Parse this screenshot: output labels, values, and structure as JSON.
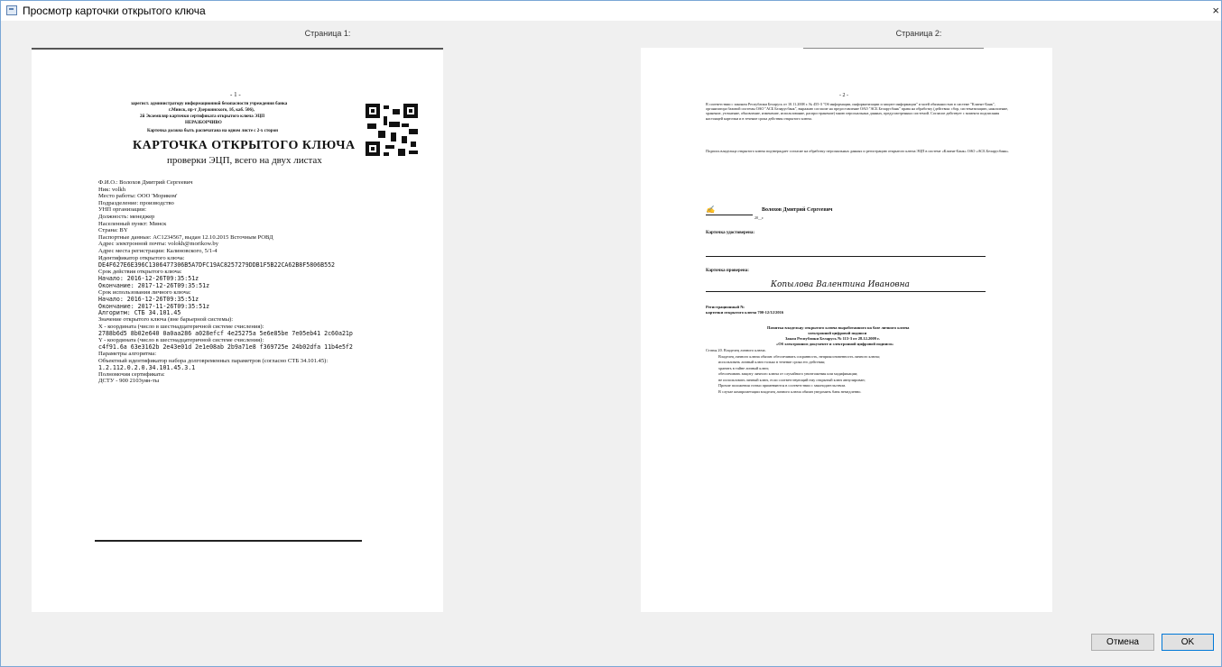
{
  "window": {
    "title": "Просмотр карточки открытого ключа",
    "close_glyph": "×"
  },
  "pages": {
    "page1_label": "Страница 1:",
    "page2_label": "Страница 2:"
  },
  "doc1": {
    "page_num": "- 1 -",
    "header_l1": "зарегист. администратору информационной безопасности учреждения банка",
    "header_l2": "г.Минск, пр-т Дзержинского, 1б, каб. 506),",
    "header_l3": "2й Экземпляр карточки сертификата открытого ключа ЭЦП",
    "header_l4": "НЕРАЗБОРЧИВО",
    "header_l5": "Карточка должна быть распечатана на одном листе с 2-х сторон",
    "title_main": "КАРТОЧКА ОТКРЫТОГО КЛЮЧА",
    "title_sub": "проверки ЭЦП, всего на двух листах",
    "fields": [
      "Ф.И.О.: Волохов Дмитрий Сергеевич",
      "Ник: volkh",
      "Место работы: ООО 'Мориком'",
      "Подразделение: производство",
      "УНП организации:",
      "Должность: менеджер",
      "Населенный пункт: Минск",
      "Страна: BY",
      "Паспортные данные: AC1234567, выдан 12.10.2015 Всточным РОВД",
      "Адрес электронной почты: volokh@morikow.by",
      "Адрес места регистрации: Калиновского, 5/1-4",
      "Идентификатор открытого ключа:",
      "DE4F627E6E396C1306477306B5A7DFC19AC8257279DDB1F5B22CA62B8F5806B552",
      "Срок действия открытого ключа:",
      "Начало: 2016-12-26T09:35:51z",
      "Окончание: 2017-12-26T09:35:51z",
      "Срок использования личного ключа:",
      "Начало: 2016-12-26T09:35:51z",
      "Окончание: 2017-11-26T09:35:51z",
      "Алгоритм: СТБ 34.101.45",
      "Значение открытого ключа (вне барьерной системы):",
      "X - координата (число в шестнадцатеричной системе счисления):",
      "2788b6d5 8b02e640 0a0aa286 a028efcf 4e25275a 5e6e85be 7e05eb41 2c60a21p",
      "Y - координата (число в шестнадцатеричной системе счисления):",
      "c4f91.6a 63e3162b 2e43e01d 2e1e08ab 2b9a71e8 f369725e 24b02dfa 11b4e5f2",
      "Параметры алгоритма:",
      "Объектный идентификатор набора долговременных параметров (согласно СТБ 34.101.45):",
      "1.2.112.0.2.0.34.101.45.3.1",
      "Полномочия сертификата:",
      "ДСТУ - 900 2103уян-ты"
    ]
  },
  "doc2": {
    "page_num": "- 2 -",
    "intro": "В соответствии с законом Республики Беларусь от 10.11.2008 г. № 455-З \"Об информации, информатизации и защите информации\" и моей обязанностью в системе \"Клиент-Банк\", организатора базовой системы ОАО \"АСБ Беларусбанк\", выражаю согласие на предоставление ОАО \"АСБ Беларусбанк\" права на обработку (действия: сбор, систематизацию, накопление, хранение, уточнение, обновление, изменение, использование, распространение) мною персональных данных, предусмотренных системой. Согласие действует с момента подписания настоящей карточки и в течение срока действия открытого ключа.",
    "consent": "Подпись владельца открытого ключа подтверждает согласие на обработку персональных данных и регистрацию открытого ключа ЭЦП в системе «Клиент-Банк» ОАО «АСБ Беларусбанк».",
    "signer": "Волохов Дмитрий Сергеевич",
    "date_sfx": "20__г.",
    "card_verified": "Карточка удостоверена:",
    "card_checked": "Карточка проверена:",
    "sign_name": "Копылова  Валентина  Ивановна",
    "reg_no": "Регистрационный №",
    "reg_card": "карточки открытого ключа 700-12/12/2016",
    "note_head": "Памятка владельцу открытого ключа выработанного на базе личного ключа",
    "note_h2": "электронной цифровой подписи",
    "note_h3": "Закон Республики Беларусь № 113-З от 28.12.2009 г.",
    "note_h4": "«Об электронном документе и электронной цифровой подписи»",
    "note_lines": [
      "Статья 20. Владелец личного ключа.",
      "Владелец личного ключа обязан: обеспечивать сохранность, неприкосновенность личного ключа;",
      "использовать личный ключ только в течение срока его действия;",
      "хранить в тайне личный ключ;",
      "обеспечивать защиту личного ключа от случайного уничтожения или модификации;",
      "не использовать личный ключ, если соответствующий ему открытый ключ аннулирован;",
      "Прочие положения статьи применяются в соответствии с законодательством.",
      "В случае компрометации владелец личного ключа обязан уведомить банк немедленно."
    ]
  },
  "buttons": {
    "cancel": "Отмена",
    "ok": "OK"
  }
}
